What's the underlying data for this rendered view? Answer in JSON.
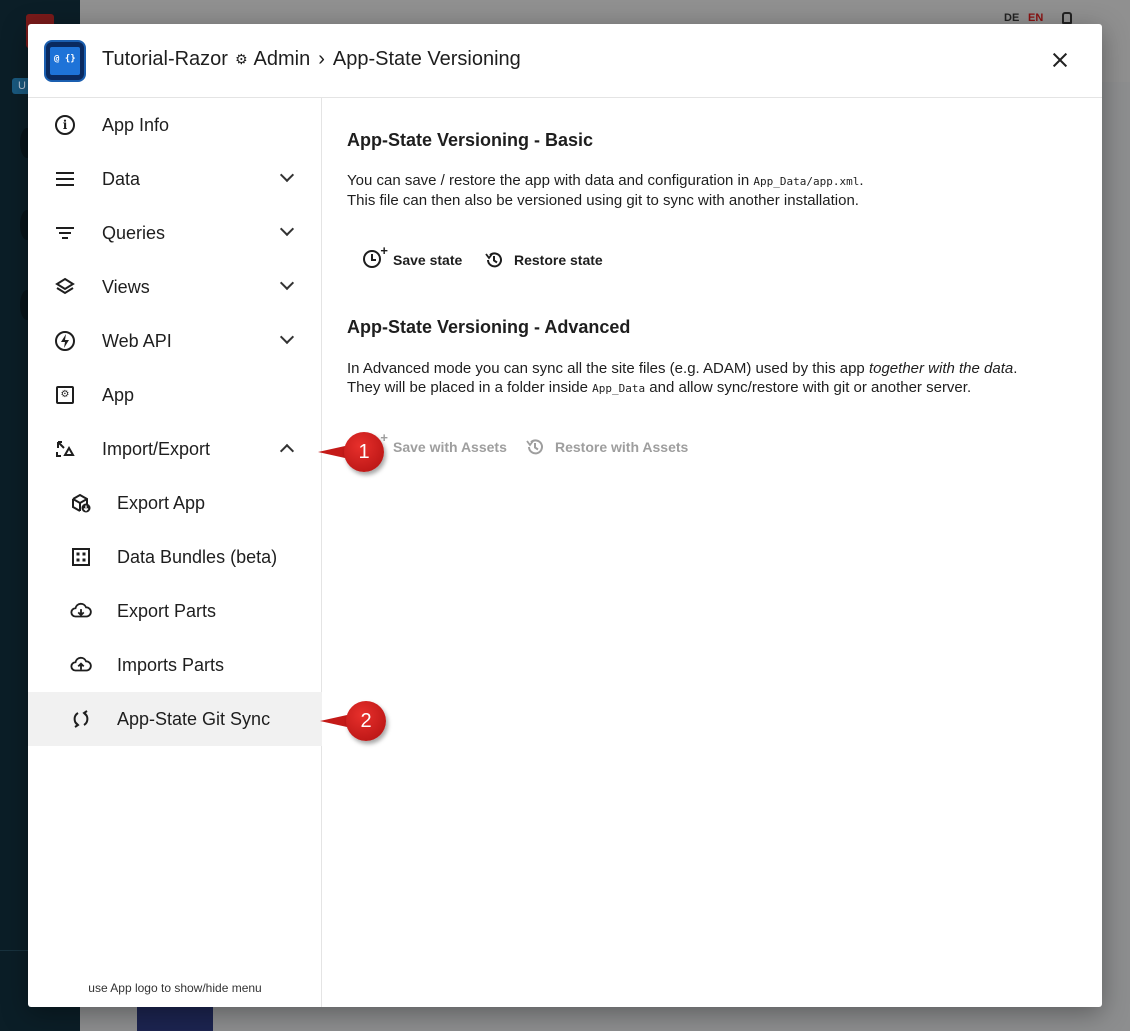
{
  "background": {
    "lang_de": "DE",
    "lang_en": "EN",
    "badge": "U"
  },
  "dialog": {
    "breadcrumb": {
      "app_name": "Tutorial-Razor",
      "section": "Admin",
      "page": "App-State Versioning"
    },
    "close_label": "Close"
  },
  "sidebar": {
    "items": [
      {
        "label": "App Info",
        "icon": "info-icon"
      },
      {
        "label": "Data",
        "icon": "menu-icon"
      },
      {
        "label": "Queries",
        "icon": "filter-icon"
      },
      {
        "label": "Views",
        "icon": "layers-icon"
      },
      {
        "label": "Web API",
        "icon": "bolt-icon"
      },
      {
        "label": "App",
        "icon": "settings-box-icon"
      },
      {
        "label": "Import/Export",
        "icon": "import-export-icon"
      }
    ],
    "subitems": [
      {
        "label": "Export App",
        "icon": "package-export-icon"
      },
      {
        "label": "Data Bundles (beta)",
        "icon": "grid-box-icon"
      },
      {
        "label": "Export Parts",
        "icon": "cloud-download-icon"
      },
      {
        "label": "Imports Parts",
        "icon": "cloud-upload-icon"
      },
      {
        "label": "App-State Git Sync",
        "icon": "sync-icon"
      }
    ],
    "footer": "use App logo to show/hide menu"
  },
  "main": {
    "basic": {
      "title": "App-State Versioning - Basic",
      "line1_pre": "You can save / restore the app with data and configuration in ",
      "line1_code": "App_Data/app.xml",
      "line1_post": ".",
      "line2": "This file can then also be versioned using git to sync with another installation.",
      "save_label": "Save state",
      "restore_label": "Restore state"
    },
    "advanced": {
      "title": "App-State Versioning - Advanced",
      "line1_pre": "In Advanced mode you can sync all the site files (e.g. ADAM) used by this app ",
      "line1_em": "together with the data",
      "line1_post": ".",
      "line2_pre": "They will be placed in a folder inside ",
      "line2_code": "App_Data",
      "line2_post": " and allow sync/restore with git or another server.",
      "save_label": "Save with Assets",
      "restore_label": "Restore with Assets"
    }
  },
  "callouts": [
    "1",
    "2"
  ]
}
